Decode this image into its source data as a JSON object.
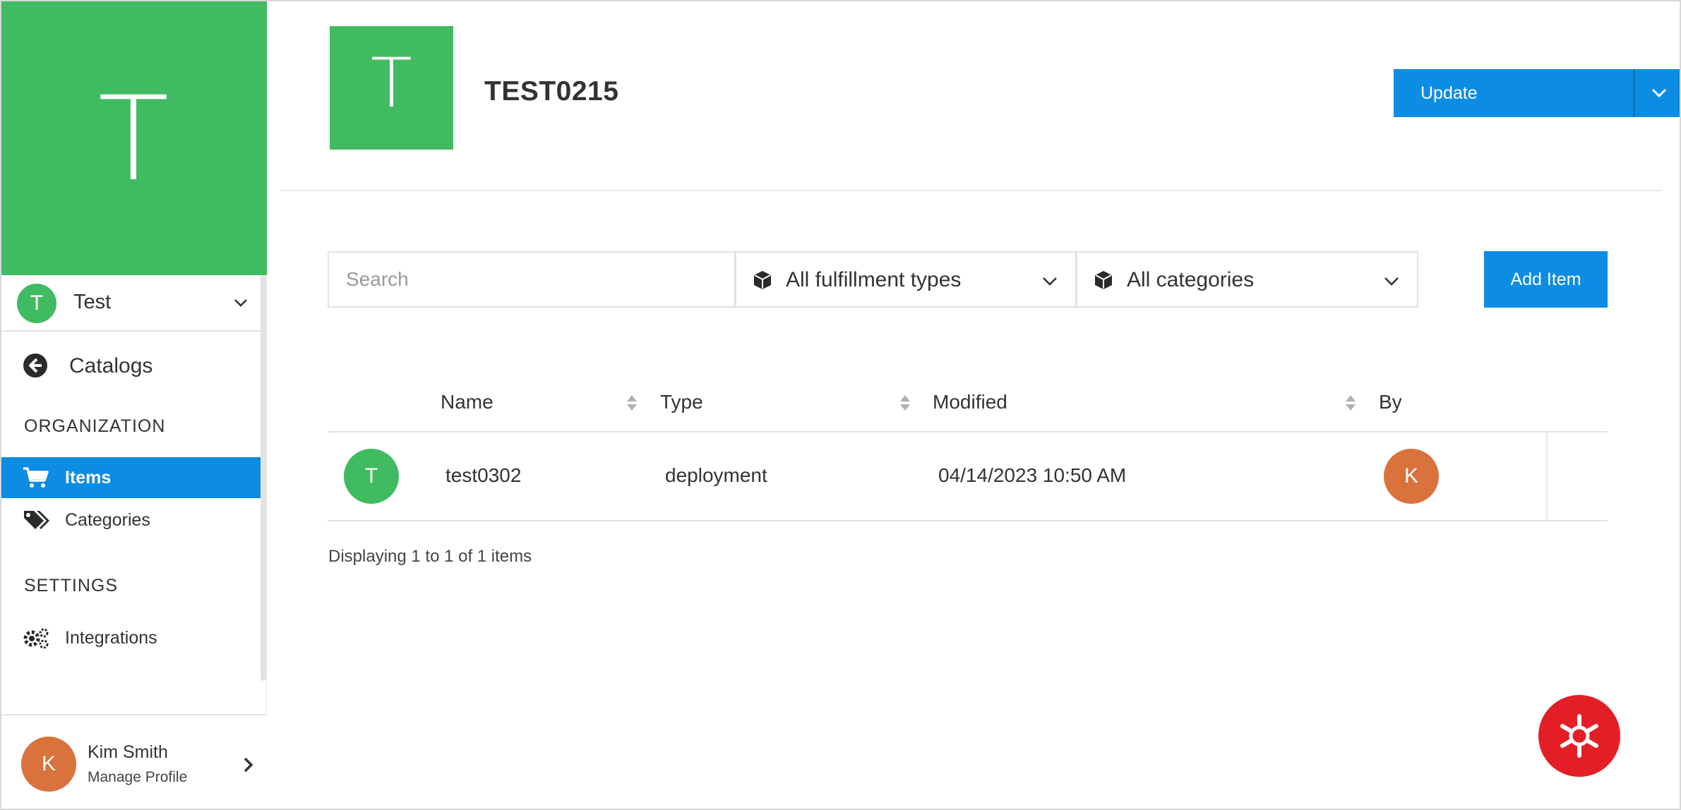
{
  "sidebar": {
    "hero_letter": "T",
    "org": {
      "avatar_letter": "T",
      "name": "Test"
    },
    "back_label": "Catalogs",
    "sections": [
      {
        "title": "ORGANIZATION"
      },
      {
        "title": "SETTINGS"
      }
    ],
    "items": [
      {
        "label": "Items",
        "icon": "cart-icon",
        "active": true
      },
      {
        "label": "Categories",
        "icon": "tags-icon",
        "active": false
      },
      {
        "label": "Integrations",
        "icon": "gears-icon",
        "active": false
      }
    ],
    "user": {
      "avatar_letter": "K",
      "name": "Kim Smith",
      "manage_label": "Manage Profile"
    }
  },
  "header": {
    "logo_letter": "T",
    "title": "TEST0215",
    "update_label": "Update"
  },
  "filters": {
    "search_placeholder": "Search",
    "fulfillment_label": "All fulfillment types",
    "categories_label": "All categories",
    "add_label": "Add Item"
  },
  "table": {
    "columns": [
      "Name",
      "Type",
      "Modified",
      "By"
    ],
    "rows": [
      {
        "avatar_letter": "T",
        "name": "test0302",
        "type": "deployment",
        "modified": "04/14/2023 10:50 AM",
        "by_letter": "K"
      }
    ],
    "paging": "Displaying 1 to 1 of 1 items"
  },
  "colors": {
    "brand_green": "#41bb61",
    "accent_blue": "#0d8ce4",
    "user_orange": "#d9723c",
    "help_red": "#e41e26"
  }
}
